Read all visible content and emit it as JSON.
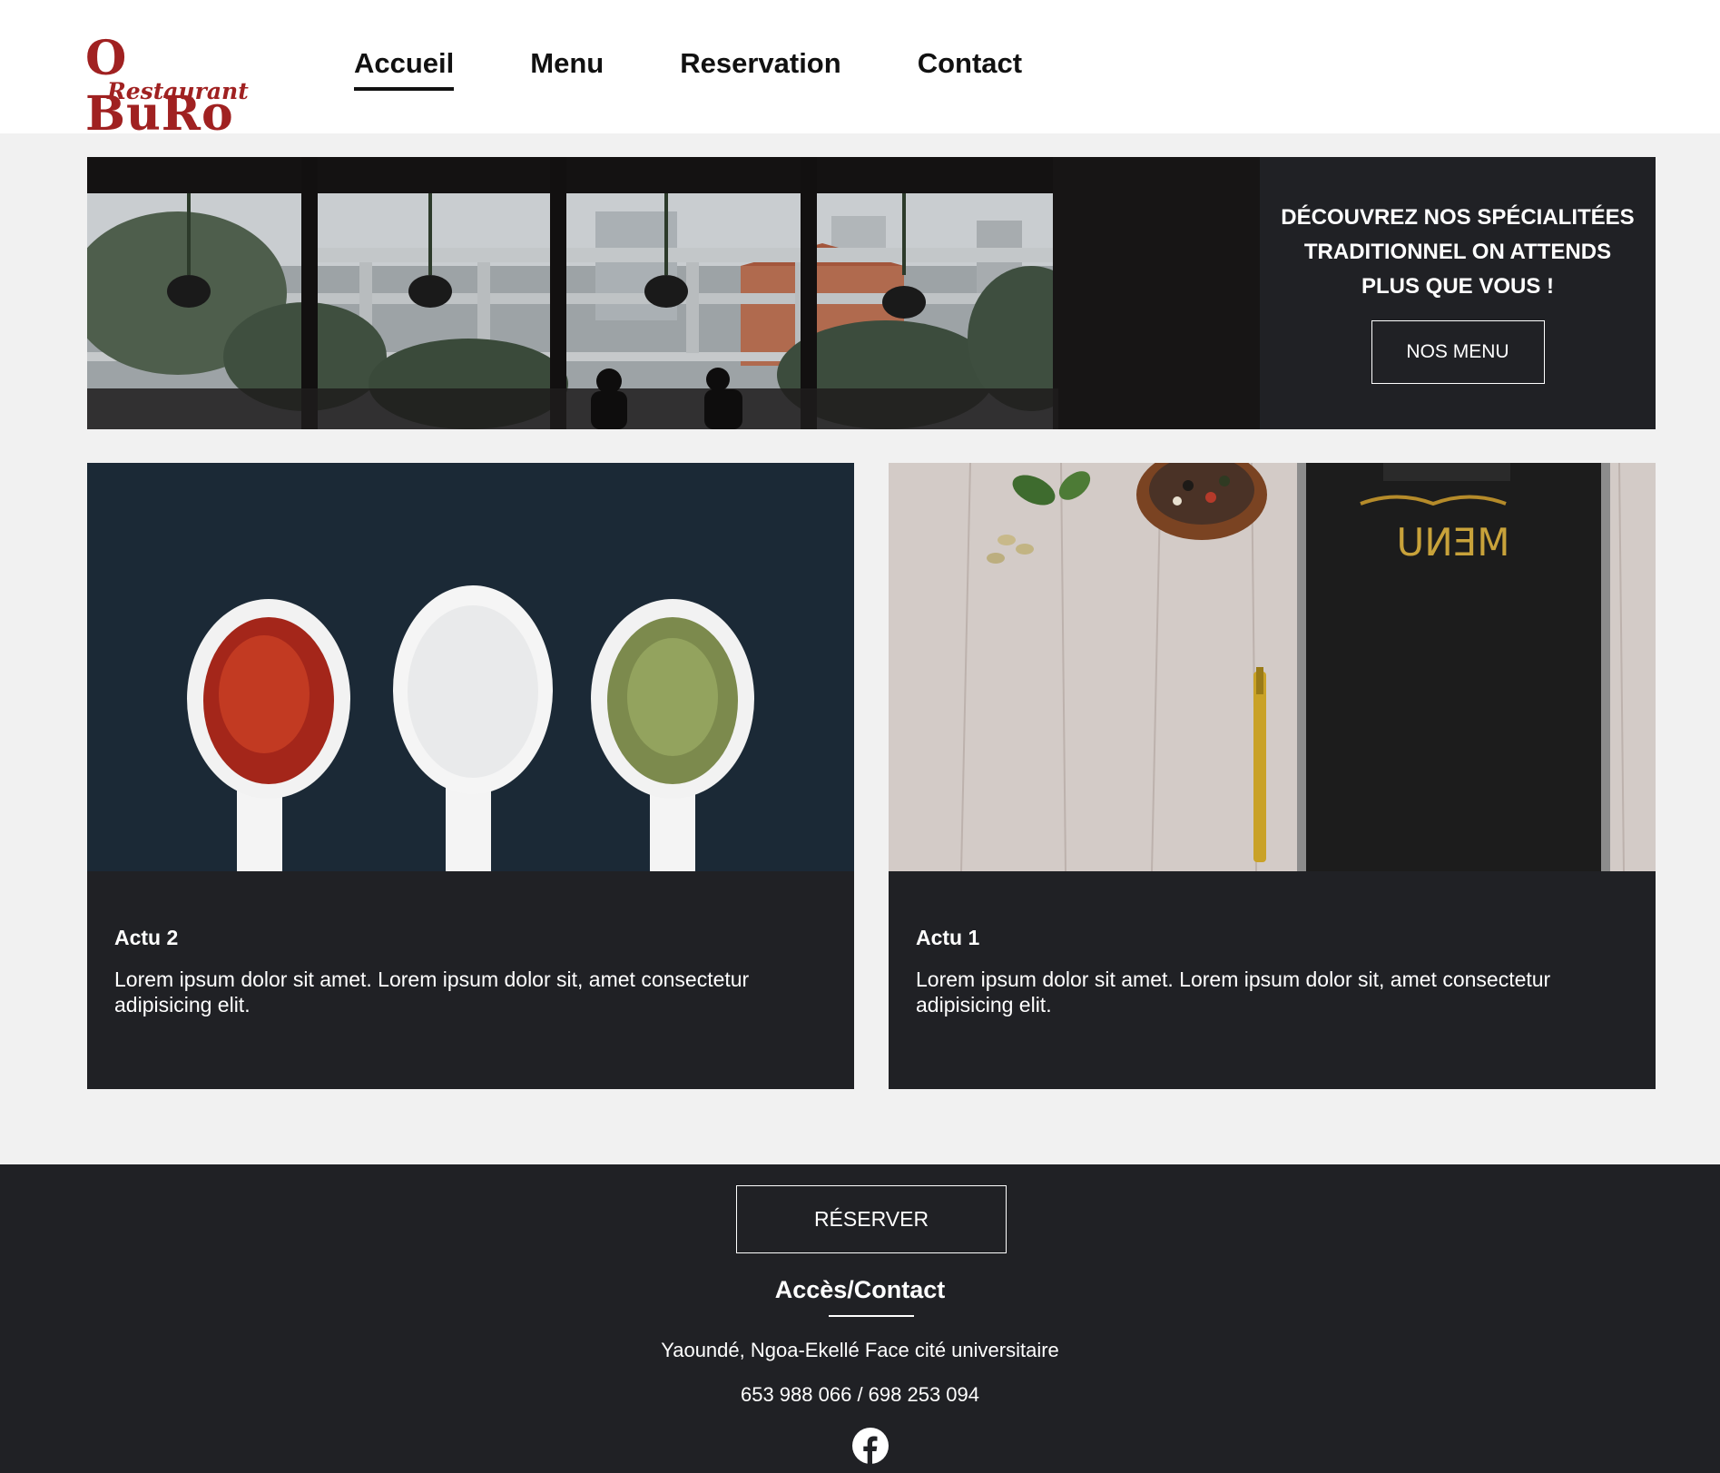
{
  "brand": {
    "logo_top": "O BuRo",
    "logo_bottom": "Restaurant",
    "color": "#a02121"
  },
  "nav": {
    "items": [
      {
        "label": "Accueil",
        "active": true
      },
      {
        "label": "Menu",
        "active": false
      },
      {
        "label": "Reservation",
        "active": false
      },
      {
        "label": "Contact",
        "active": false
      }
    ]
  },
  "hero": {
    "text": "DÉCOUVREZ NOS SPÉCIALITÉES TRADITIONNEL ON ATTENDS PLUS QUE VOUS !",
    "button": "NOS MENU"
  },
  "cards": [
    {
      "title": "Actu 2",
      "text": "Lorem ipsum dolor sit amet. Lorem ipsum dolor sit, amet consectetur adipisicing elit."
    },
    {
      "title": "Actu 1",
      "text": "Lorem ipsum dolor sit amet. Lorem ipsum dolor sit, amet consectetur adipisicing elit.",
      "menu_board_text": "MENU"
    }
  ],
  "footer": {
    "reserve_button": "RÉSERVER",
    "title": "Accès/Contact",
    "address": "Yaoundé, Ngoa-Ekellé Face cité universitaire",
    "phone": "653 988 066 / 698 253 094",
    "social_icon": "facebook-icon"
  },
  "colors": {
    "dark_panel": "#202125",
    "page_bg": "#f1f1f1",
    "header_bg": "#ffffff"
  }
}
